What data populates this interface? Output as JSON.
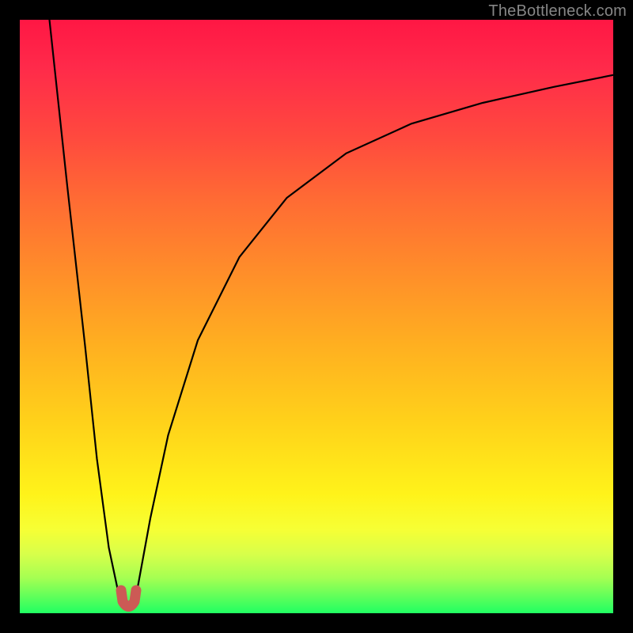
{
  "watermark": "TheBottleneck.com",
  "chart_data": {
    "type": "line",
    "title": "",
    "xlabel": "",
    "ylabel": "",
    "xlim": [
      0,
      100
    ],
    "ylim": [
      0,
      100
    ],
    "grid": false,
    "note": "Axes unlabeled; values are estimated from pixel positions. y maps to the vertical gradient (red≈100 top, green≈0 bottom).",
    "series": [
      {
        "name": "bottleneck-curve",
        "color": "#000000",
        "x": [
          5,
          8,
          11,
          13,
          15,
          16.5,
          17.8,
          18.9,
          19.8,
          22,
          25,
          30,
          37,
          45,
          55,
          66,
          78,
          90,
          100
        ],
        "y": [
          100,
          72,
          45,
          26,
          11,
          4.0,
          1.3,
          1.3,
          4.0,
          16,
          30,
          46,
          60,
          70,
          77.5,
          82.5,
          86,
          88.7,
          90.7
        ]
      },
      {
        "name": "minimum-marker",
        "color": "#cc5a55",
        "shape": "u-notch",
        "x": [
          17.8,
          18.9
        ],
        "y": [
          1.3,
          1.3
        ]
      }
    ]
  }
}
